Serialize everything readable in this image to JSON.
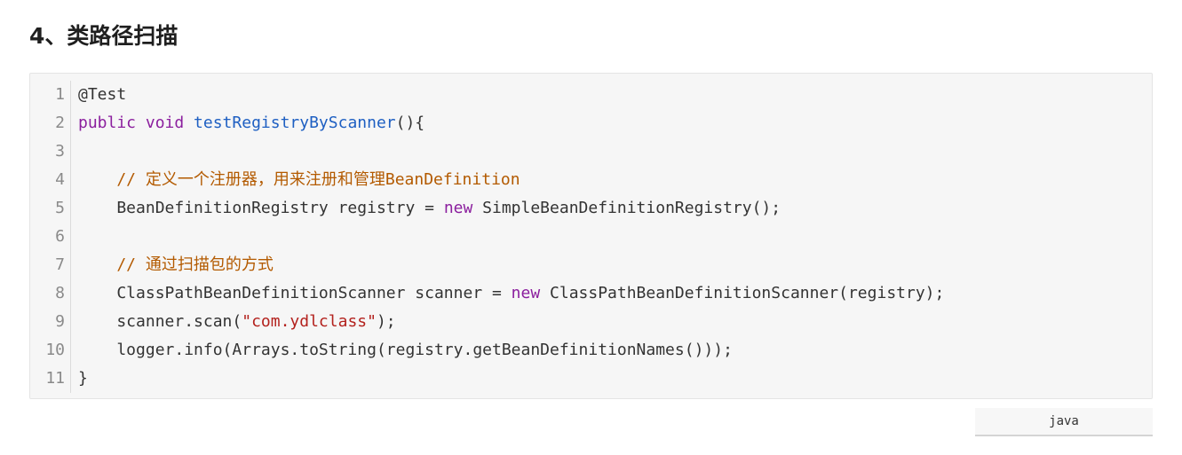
{
  "heading": "4、类路径扫描",
  "language": "java",
  "line_numbers": [
    "1",
    "2",
    "3",
    "4",
    "5",
    "6",
    "7",
    "8",
    "9",
    "10",
    "11"
  ],
  "code": {
    "l1": {
      "plain": "@Test"
    },
    "l2": {
      "kw": "public void ",
      "fn": "testRegistryByScanner",
      "rest": "(){"
    },
    "l3": {
      "plain": ""
    },
    "l4": {
      "comment": "    // 定义一个注册器，用来注册和管理BeanDefinition"
    },
    "l5": {
      "a": "    BeanDefinitionRegistry registry = ",
      "kw": "new",
      "b": " SimpleBeanDefinitionRegistry();"
    },
    "l6": {
      "plain": ""
    },
    "l7": {
      "comment": "    // 通过扫描包的方式"
    },
    "l8": {
      "a": "    ClassPathBeanDefinitionScanner scanner = ",
      "kw": "new",
      "b": " ClassPathBeanDefinitionScanner(registry);"
    },
    "l9": {
      "a": "    scanner.scan(",
      "str": "\"com.ydlclass\"",
      "b": ");"
    },
    "l10": {
      "plain": "    logger.info(Arrays.toString(registry.getBeanDefinitionNames()));"
    },
    "l11": {
      "plain": "}"
    }
  }
}
